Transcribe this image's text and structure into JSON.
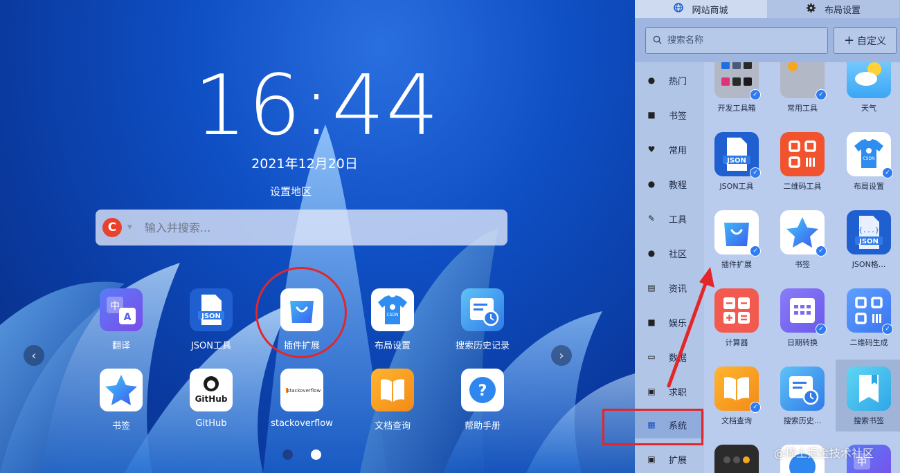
{
  "desktop": {
    "clock": "16:44",
    "date": "2021年12月20日",
    "region_link": "设置地区",
    "search": {
      "engine_icon": "c-search-engine-icon",
      "placeholder": "输入并搜索..."
    },
    "apps": [
      {
        "label": "翻译",
        "icon": "translate-icon"
      },
      {
        "label": "JSON工具",
        "icon": "json-file-icon"
      },
      {
        "label": "插件扩展",
        "icon": "shopping-bag-icon"
      },
      {
        "label": "布局设置",
        "icon": "tshirt-icon"
      },
      {
        "label": "搜索历史记录",
        "icon": "calendar-history-icon"
      },
      {
        "label": "书签",
        "icon": "star-icon"
      },
      {
        "label": "GitHub",
        "icon": "github-icon"
      },
      {
        "label": "stackoverflow",
        "icon": "stackoverflow-icon"
      },
      {
        "label": "文档查询",
        "icon": "open-book-icon"
      },
      {
        "label": "帮助手册",
        "icon": "question-icon"
      }
    ],
    "github_icon_text": "GitHub",
    "stackoverflow_icon_text": "stackoverflow",
    "json_badge_text": "JSON",
    "csdn_badge_text": "CSDN",
    "page_count": 2,
    "active_page": 2
  },
  "panel": {
    "tabs": [
      {
        "label": "网站商城",
        "icon": "globe-icon",
        "active": true
      },
      {
        "label": "布局设置",
        "icon": "gear-icon",
        "active": false
      }
    ],
    "search_placeholder": "搜索名称",
    "custom_button": "自定义",
    "categories": [
      {
        "label": "热门",
        "icon": "fire-icon"
      },
      {
        "label": "书签",
        "icon": "bookmark-icon"
      },
      {
        "label": "常用",
        "icon": "heart-icon"
      },
      {
        "label": "教程",
        "icon": "user-icon"
      },
      {
        "label": "工具",
        "icon": "wrench-icon"
      },
      {
        "label": "社区",
        "icon": "group-icon"
      },
      {
        "label": "资讯",
        "icon": "chart-icon"
      },
      {
        "label": "娱乐",
        "icon": "video-icon"
      },
      {
        "label": "数据",
        "icon": "monitor-icon"
      },
      {
        "label": "求职",
        "icon": "briefcase-icon"
      },
      {
        "label": "系统",
        "icon": "system-icon",
        "active": true
      },
      {
        "label": "扩展",
        "icon": "extension-icon"
      }
    ],
    "grid": [
      {
        "label": "开发工具箱",
        "checked": true
      },
      {
        "label": "常用工具",
        "checked": true
      },
      {
        "label": "天气",
        "checked": false
      },
      {
        "label": "JSON工具",
        "checked": true
      },
      {
        "label": "二维码工具",
        "checked": false
      },
      {
        "label": "布局设置",
        "checked": true
      },
      {
        "label": "插件扩展",
        "checked": true
      },
      {
        "label": "书签",
        "checked": true
      },
      {
        "label": "JSON格...",
        "checked": false
      },
      {
        "label": "计算器",
        "checked": false
      },
      {
        "label": "日期转换",
        "checked": true
      },
      {
        "label": "二维码生成",
        "checked": true
      },
      {
        "label": "文档查询",
        "checked": true
      },
      {
        "label": "搜索历史...",
        "checked": false
      },
      {
        "label": "搜索书签",
        "checked": false
      }
    ],
    "json_badge_text": "JSON",
    "json_format_badge_text": "{...}",
    "csdn_badge_text": "CSDN",
    "translate_glyph_zh": "中",
    "translate_glyph_a": "A"
  },
  "watermark": "@稀土掘金技术社区",
  "colors": {
    "accent": "#2e7bf2",
    "annotation": "#e2262a",
    "engine": "#e8412c"
  }
}
